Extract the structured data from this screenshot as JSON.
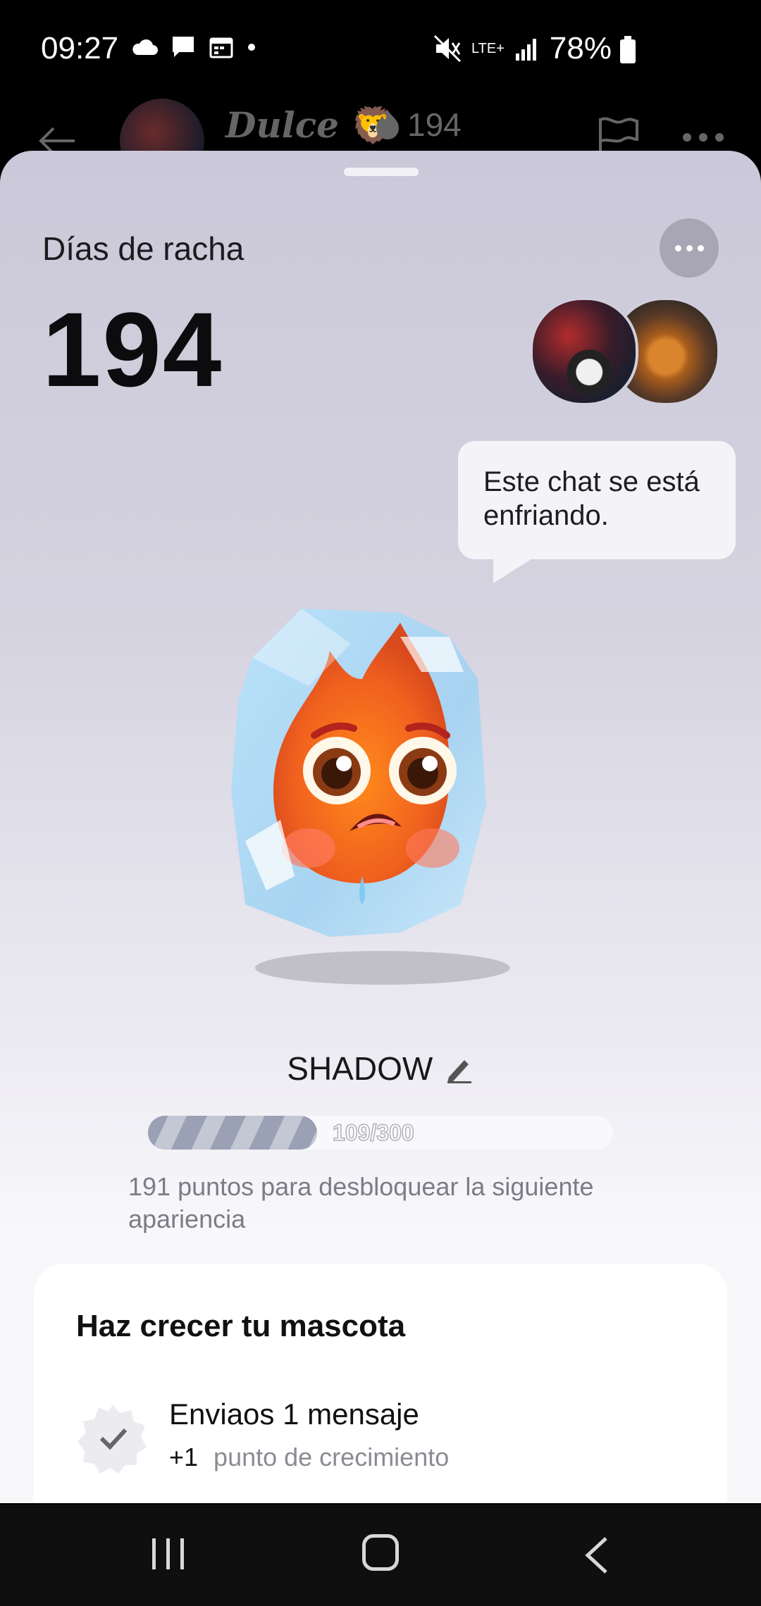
{
  "status_bar": {
    "time": "09:27",
    "network": "LTE+",
    "battery": "78%"
  },
  "chat_header": {
    "name": "Dulce",
    "name_emoji": "🦁",
    "streak_count": "194"
  },
  "sheet": {
    "title": "Días de racha",
    "streak_days": "194",
    "bubble_text": "Este chat se está enfriando.",
    "pet_name": "SHADOW",
    "progress": {
      "current": 109,
      "max": 300,
      "label": "109/300"
    },
    "points_text": "191 puntos para desbloquear la siguiente apariencia"
  },
  "card": {
    "title": "Haz crecer tu mascota",
    "tasks": [
      {
        "title": "Enviaos 1 mensaje",
        "points": "+1",
        "subtitle": "punto de crecimiento"
      }
    ]
  },
  "colors": {
    "sheet_top": "#cbc8d9",
    "progress_fill": "#9aa1b5",
    "ice": "#a9d8f5",
    "fire": "#f06a1c"
  }
}
